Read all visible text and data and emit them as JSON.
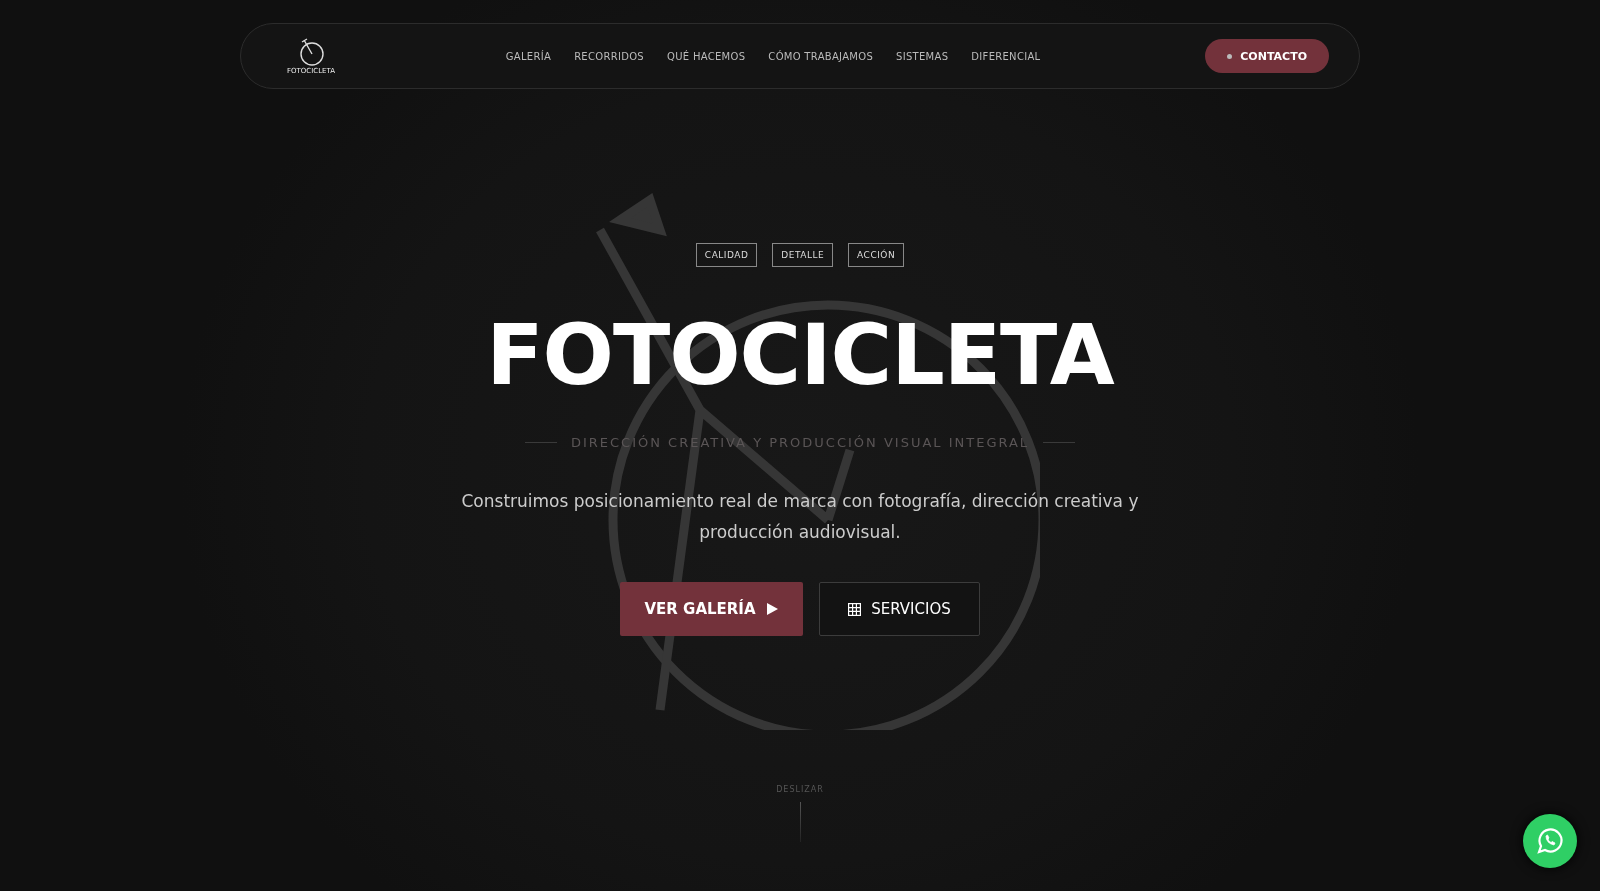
{
  "logo": {
    "text": "FOTOCICLETA"
  },
  "nav": {
    "items": [
      "GALERÍA",
      "RECORRIDOS",
      "QUÉ HACEMOS",
      "CÓMO TRABAJAMOS",
      "SISTEMAS",
      "DIFERENCIAL"
    ],
    "cta": "CONTACTO"
  },
  "hero": {
    "tags": [
      "CALIDAD",
      "DETALLE",
      "ACCIÓN"
    ],
    "title": "FOTOCICLETA",
    "subtitle": "DIRECCIÓN CREATIVA Y PRODUCCIÓN VISUAL INTEGRAL",
    "description": "Construimos posicionamiento real de marca con fotografía, dirección creativa y producción audiovisual.",
    "buttons": [
      {
        "kind": "primary",
        "label": "VER GALERÍA"
      },
      {
        "kind": "secondary",
        "label": "SERVICIOS"
      }
    ]
  },
  "scroll_hint": "DESLIZAR"
}
